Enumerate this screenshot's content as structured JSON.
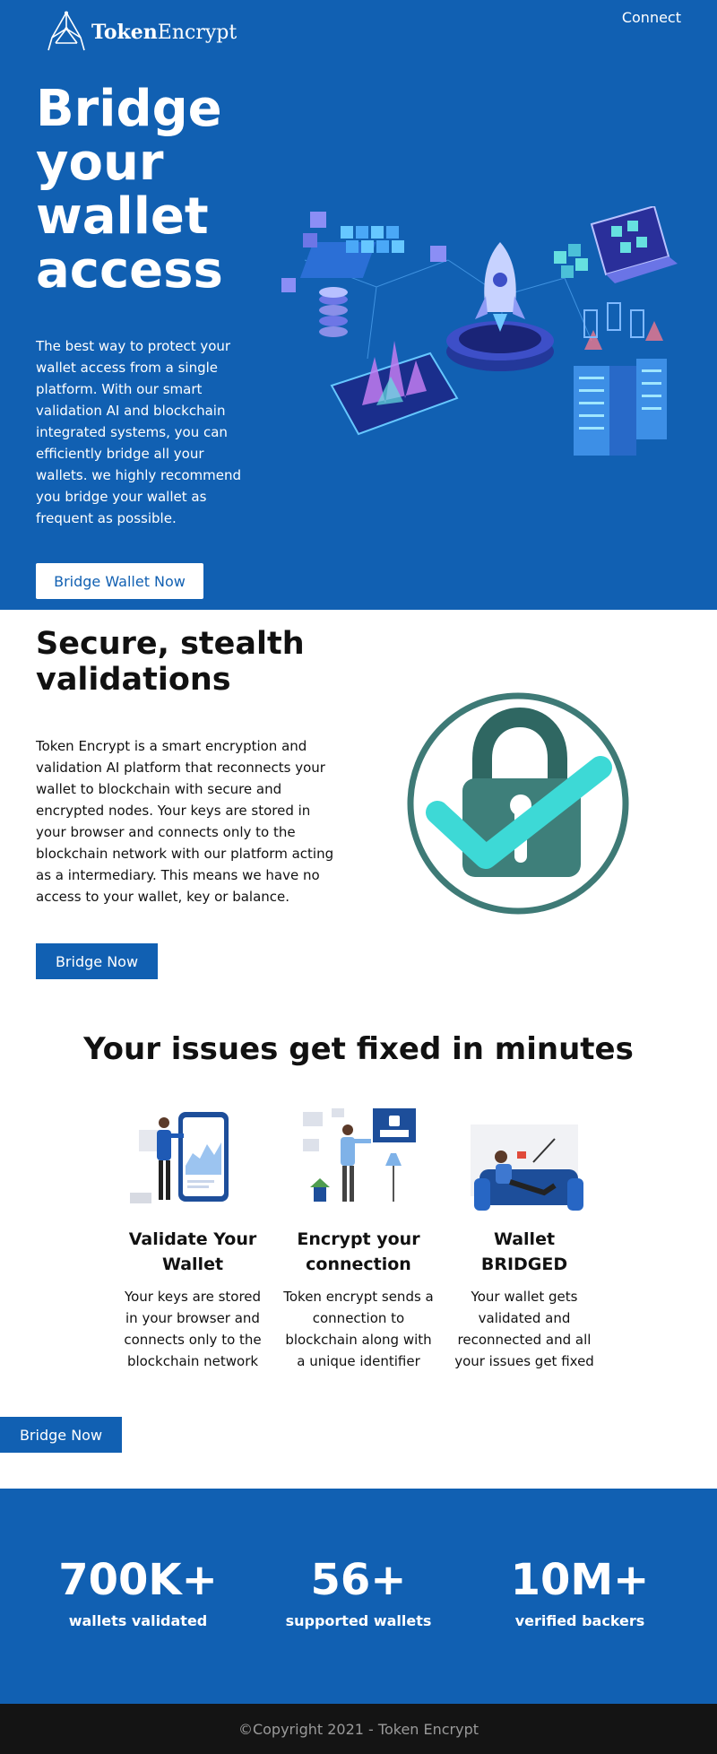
{
  "header": {
    "logo_bold": "Token",
    "logo_rest": "Encrypt",
    "connect_label": "Connect"
  },
  "hero": {
    "title": "Bridge your wallet access",
    "description": "The best way to protect your wallet access from a single platform. With our smart validation AI and blockchain integrated systems, you can efficiently bridge all your wallets. we highly recommend you bridge your wallet as frequent as possible.",
    "cta_label": "Bridge Wallet Now"
  },
  "secure": {
    "title": "Secure, stealth validations",
    "description": "Token Encrypt is a smart encryption and validation AI platform that reconnects your wallet to blockchain with secure and encrypted nodes. Your keys are stored in your browser and connects only to the blockchain network with our platform acting as a intermediary. This means we have no access to your wallet, key or balance.",
    "cta_label": "Bridge Now"
  },
  "issues": {
    "title": "Your issues get fixed in minutes",
    "cards": [
      {
        "title": "Validate Your Wallet",
        "description": "Your keys are stored in your browser and connects only to the blockchain network"
      },
      {
        "title": "Encrypt your connection",
        "description": "Token encrypt sends a connection to blockchain along with a unique identifier"
      },
      {
        "title": "Wallet BRIDGED",
        "description": "Your wallet gets validated and reconnected and all your issues get fixed"
      }
    ],
    "cta_label": "Bridge Now"
  },
  "stats": [
    {
      "value": "700K+",
      "label": "wallets validated"
    },
    {
      "value": "56+",
      "label": "supported wallets"
    },
    {
      "value": "10M+",
      "label": "verified backers"
    }
  ],
  "footer": {
    "copyright": "©Copyright 2021 - Token Encrypt"
  },
  "colors": {
    "brand_blue": "#1160b2",
    "footer_bg": "#141414",
    "lock_teal": "#3e7f7a",
    "check_cyan": "#3dd9d6"
  }
}
